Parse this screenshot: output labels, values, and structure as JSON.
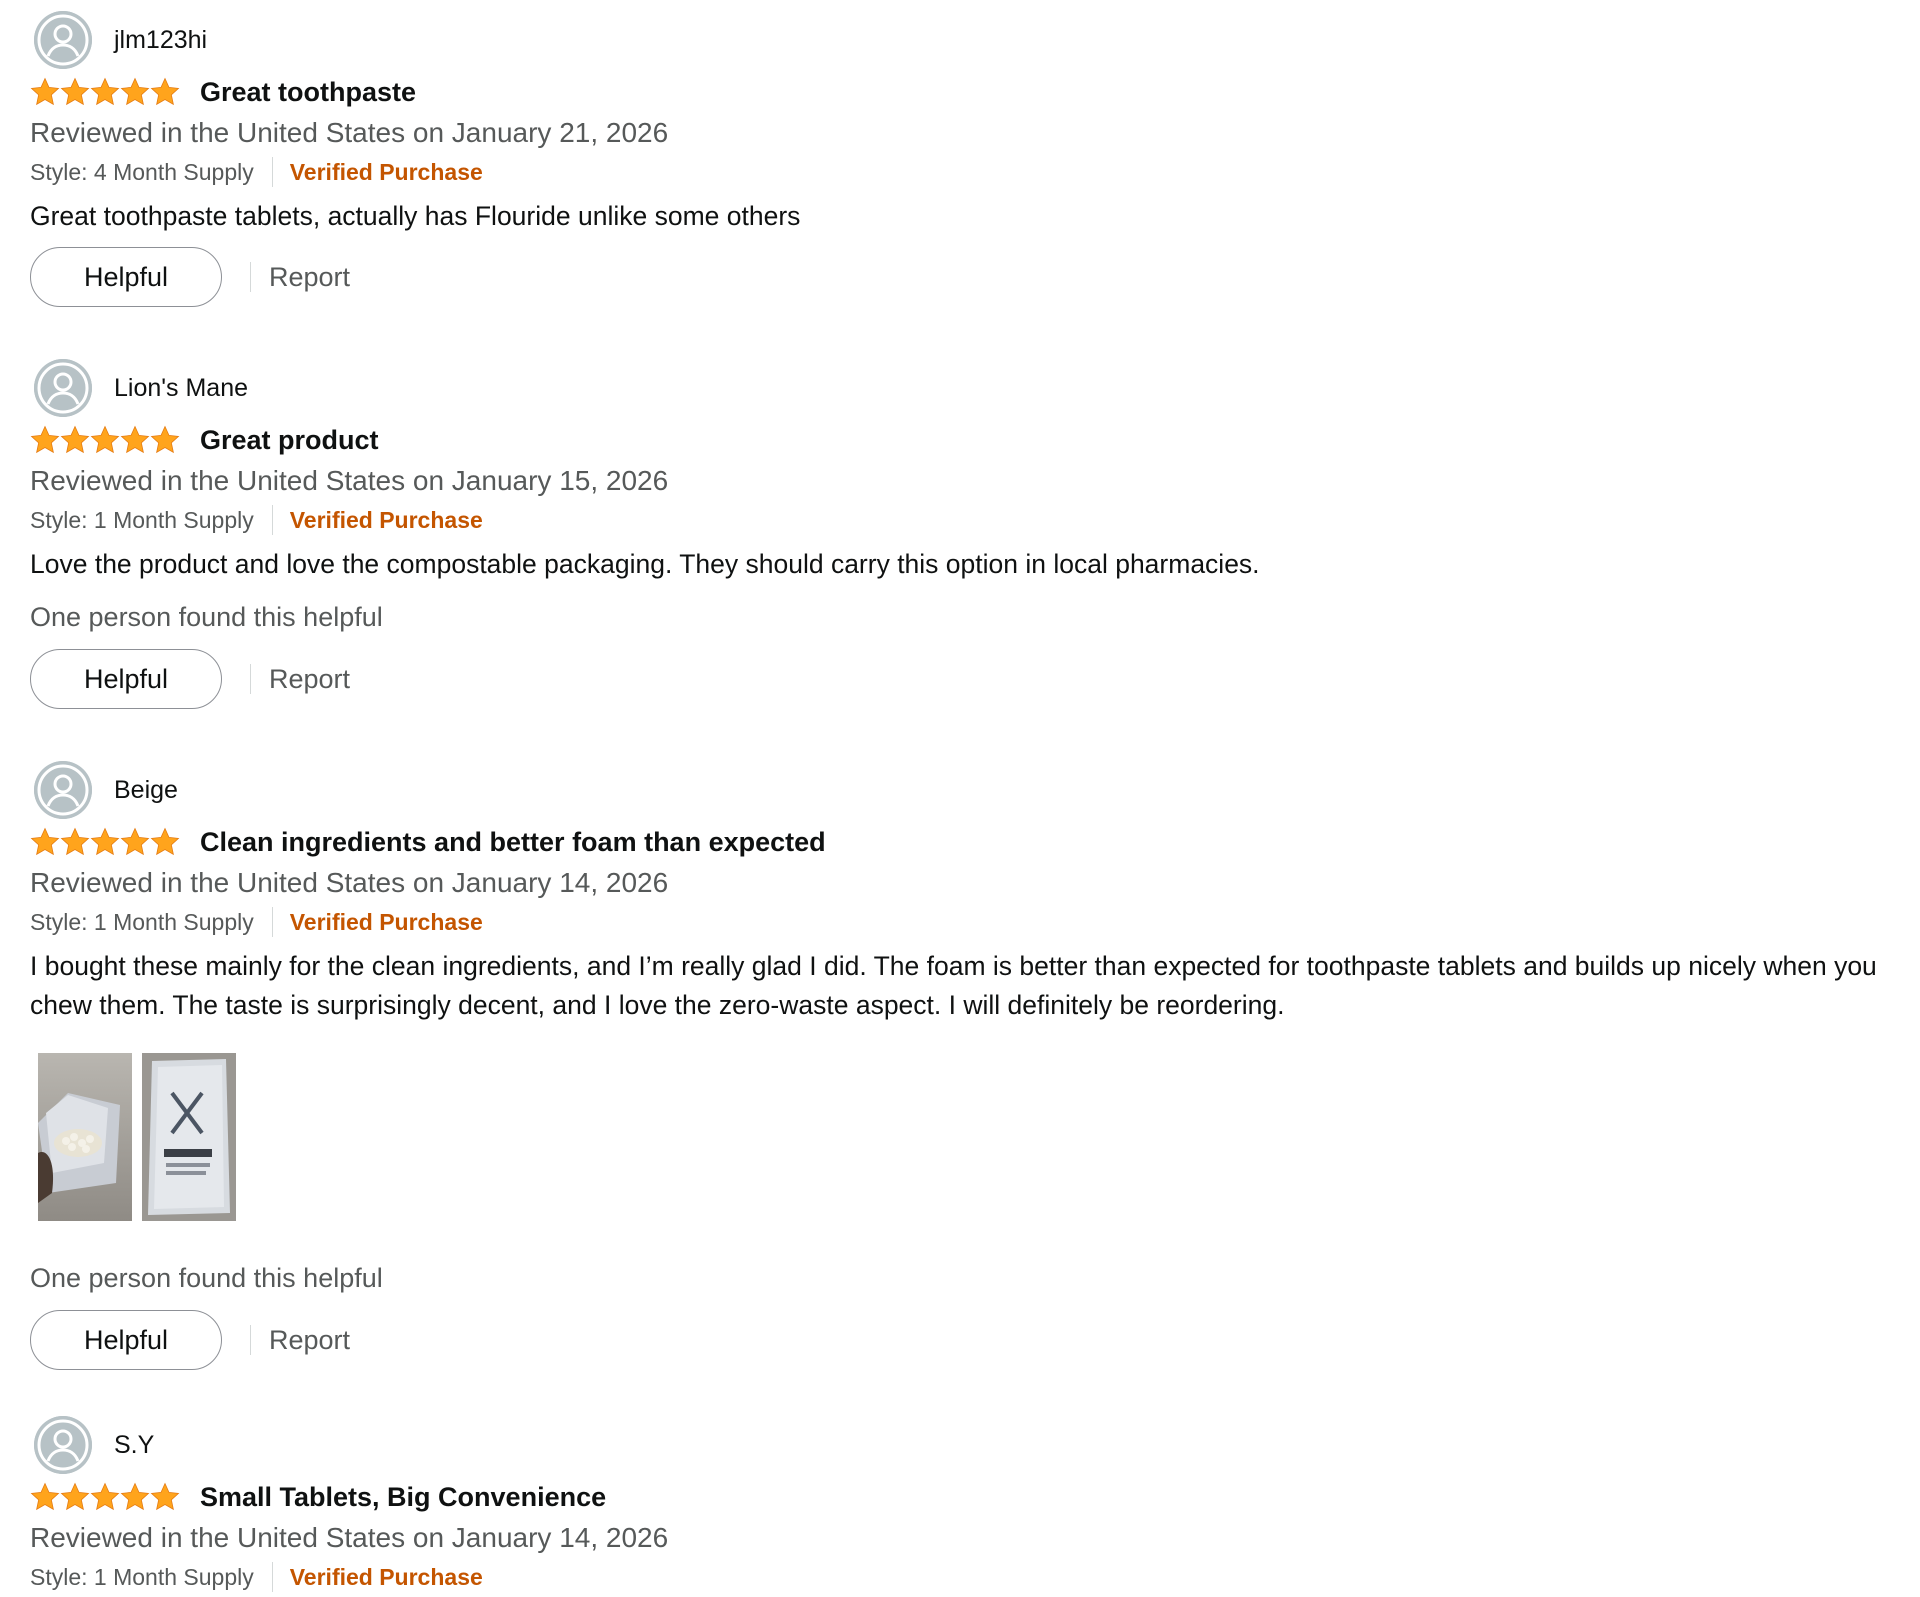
{
  "colors": {
    "star": "#ffa41c",
    "verified": "#c45500",
    "meta_text": "#565959",
    "avatar_bg": "#b7c2c6"
  },
  "reviews": [
    {
      "reviewer": "jlm123hi",
      "rating": 5,
      "title": "Great toothpaste",
      "date_line": "Reviewed in the United States on January 21, 2026",
      "style": "Style: 4 Month Supply",
      "verified": "Verified Purchase",
      "text": "Great toothpaste tablets, actually has Flouride unlike some others",
      "helpful_count": "",
      "helpful_label": "Helpful",
      "report_label": "Report"
    },
    {
      "reviewer": "Lion's Mane",
      "rating": 5,
      "title": "Great product",
      "date_line": "Reviewed in the United States on January 15, 2026",
      "style": "Style: 1 Month Supply",
      "verified": "Verified Purchase",
      "text": "Love the product and love the compostable packaging. They should carry this option in local pharmacies.",
      "helpful_count": "One person found this helpful",
      "helpful_label": "Helpful",
      "report_label": "Report"
    },
    {
      "reviewer": "Beige",
      "rating": 5,
      "title": "Clean ingredients and better foam than expected",
      "date_line": "Reviewed in the United States on January 14, 2026",
      "style": "Style: 1 Month Supply",
      "verified": "Verified Purchase",
      "text": "I bought these mainly for the clean ingredients, and I’m really glad I did. The foam is better than expected for toothpaste tablets and builds up nicely when you chew them. The taste is surprisingly decent, and I love the zero-waste aspect. I will definitely be reordering.",
      "helpful_count": "One person found this helpful",
      "helpful_label": "Helpful",
      "report_label": "Report"
    },
    {
      "reviewer": "S.Y",
      "rating": 5,
      "title": "Small Tablets, Big Convenience",
      "date_line": "Reviewed in the United States on January 14, 2026",
      "style": "Style: 1 Month Supply",
      "verified": "Verified Purchase"
    }
  ]
}
